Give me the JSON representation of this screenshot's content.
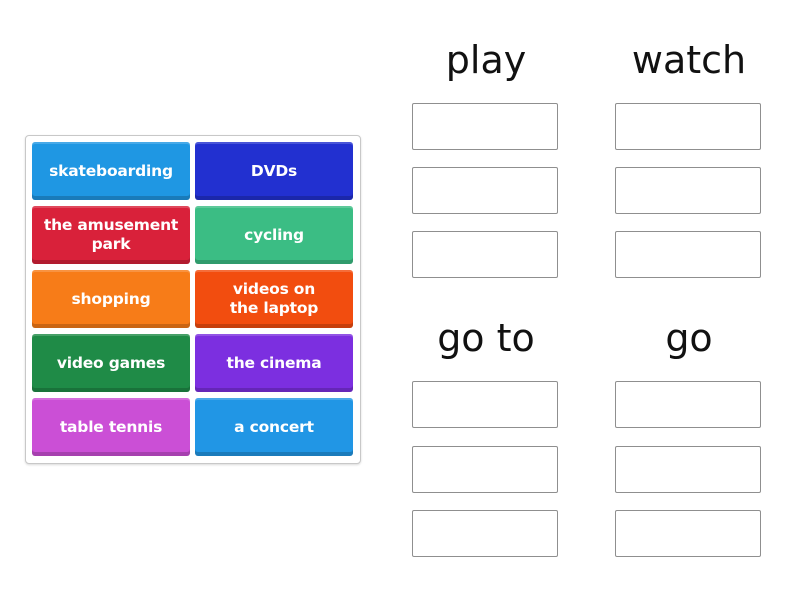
{
  "tiles": [
    {
      "label": "skateboarding",
      "color": "#1f97e3"
    },
    {
      "label": "DVDs",
      "color": "#2230d0"
    },
    {
      "label": "the amusement park",
      "color": "#d9213a"
    },
    {
      "label": "cycling",
      "color": "#3bbd84"
    },
    {
      "label": "shopping",
      "color": "#f77c18"
    },
    {
      "label": "videos on the laptop",
      "color": "#f24d0f"
    },
    {
      "label": "video games",
      "color": "#1f8b47"
    },
    {
      "label": "the cinema",
      "color": "#7c2fe0"
    },
    {
      "label": "table tennis",
      "color": "#cb4fd6"
    },
    {
      "label": "a concert",
      "color": "#2196e5"
    }
  ],
  "groups": [
    {
      "title": "play",
      "slots": 3
    },
    {
      "title": "watch",
      "slots": 3
    },
    {
      "title": "go to",
      "slots": 3
    },
    {
      "title": "go",
      "slots": 3
    }
  ]
}
